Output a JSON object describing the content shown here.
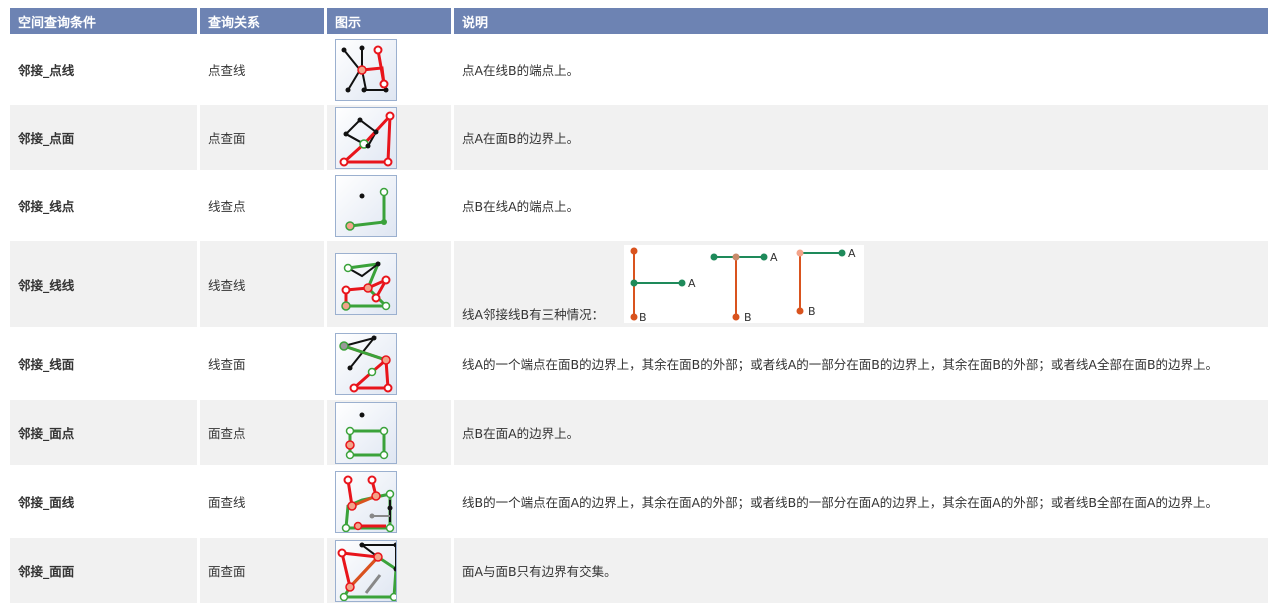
{
  "headers": {
    "condition": "空间查询条件",
    "relation": "查询关系",
    "figure": "图示",
    "description": "说明"
  },
  "rows": [
    {
      "condition": "邻接_点线",
      "relation": "点查线",
      "figure": "point-line-adjacency-icon",
      "description": "点A在线B的端点上。"
    },
    {
      "condition": "邻接_点面",
      "relation": "点查面",
      "figure": "point-polygon-adjacency-icon",
      "description": "点A在面B的边界上。"
    },
    {
      "condition": "邻接_线点",
      "relation": "线查点",
      "figure": "line-point-adjacency-icon",
      "description": "点B在线A的端点上。"
    },
    {
      "condition": "邻接_线线",
      "relation": "线查线",
      "figure": "line-line-adjacency-icon",
      "description": "线A邻接线B有三种情况：",
      "cases": {
        "label_a": "A",
        "label_b": "B"
      }
    },
    {
      "condition": "邻接_线面",
      "relation": "线查面",
      "figure": "line-polygon-adjacency-icon",
      "description": "线A的一个端点在面B的边界上，其余在面B的外部；或者线A的一部分在面B的边界上，其余在面B的外部；或者线A全部在面B的边界上。"
    },
    {
      "condition": "邻接_面点",
      "relation": "面查点",
      "figure": "polygon-point-adjacency-icon",
      "description": "点B在面A的边界上。"
    },
    {
      "condition": "邻接_面线",
      "relation": "面查线",
      "figure": "polygon-line-adjacency-icon",
      "description": "线B的一个端点在面A的边界上，其余在面A的外部；或者线B的一部分在面A的边界上，其余在面A的外部；或者线B全部在面A的边界上。"
    },
    {
      "condition": "邻接_面面",
      "relation": "面查面",
      "figure": "polygon-polygon-adjacency-icon",
      "description": "面A与面B只有边界有交集。"
    }
  ],
  "colors": {
    "header_bg": "#6d83b3",
    "row_alt": "#f1f1f1",
    "red": "#e8141b",
    "green": "#3aa23a",
    "orange_line": "#d9531e",
    "teal_line": "#1e8a5a"
  }
}
